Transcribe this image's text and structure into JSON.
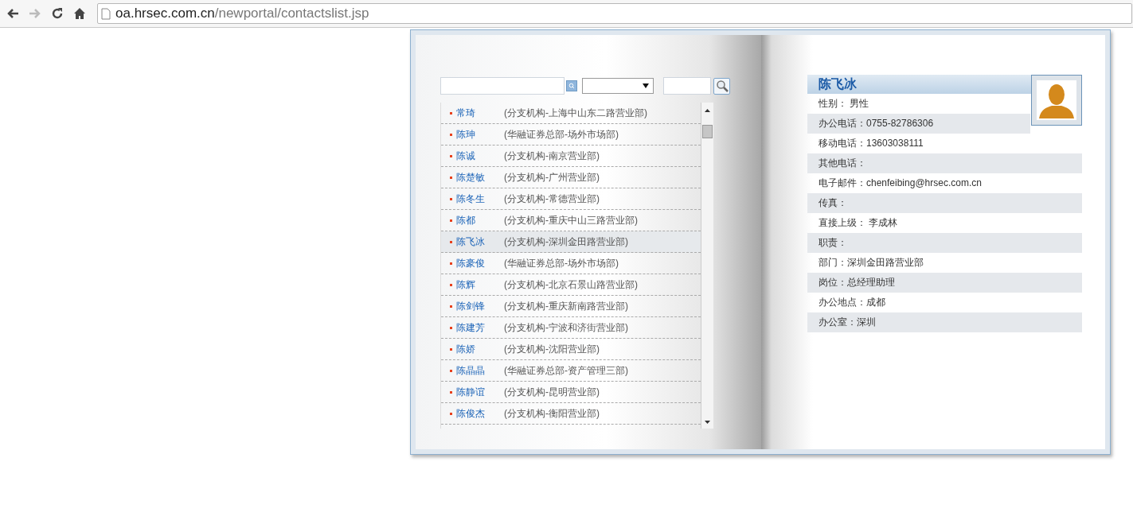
{
  "browser": {
    "url_host": "oa.hrsec.com.cn",
    "url_path": "/newportal/contactslist.jsp"
  },
  "contacts": [
    {
      "name": "常琦",
      "org": "(分支机构-上海中山东二路营业部)",
      "selected": false
    },
    {
      "name": "陈珅",
      "org": "(华融证券总部-场外市场部)",
      "selected": false
    },
    {
      "name": "陈诚",
      "org": "(分支机构-南京营业部)",
      "selected": false
    },
    {
      "name": "陈楚敏",
      "org": "(分支机构-广州营业部)",
      "selected": false
    },
    {
      "name": "陈冬生",
      "org": "(分支机构-常德营业部)",
      "selected": false
    },
    {
      "name": "陈都",
      "org": "(分支机构-重庆中山三路营业部)",
      "selected": false
    },
    {
      "name": "陈飞冰",
      "org": "(分支机构-深圳金田路营业部)",
      "selected": true
    },
    {
      "name": "陈豪俊",
      "org": "(华融证券总部-场外市场部)",
      "selected": false
    },
    {
      "name": "陈辉",
      "org": "(分支机构-北京石景山路营业部)",
      "selected": false
    },
    {
      "name": "陈剑锋",
      "org": "(分支机构-重庆新南路营业部)",
      "selected": false
    },
    {
      "name": "陈建芳",
      "org": "(分支机构-宁波和济街营业部)",
      "selected": false
    },
    {
      "name": "陈娇",
      "org": "(分支机构-沈阳营业部)",
      "selected": false
    },
    {
      "name": "陈晶晶",
      "org": "(华融证券总部-资产管理三部)",
      "selected": false
    },
    {
      "name": "陈静谊",
      "org": "(分支机构-昆明营业部)",
      "selected": false
    },
    {
      "name": "陈俊杰",
      "org": "(分支机构-衡阳营业部)",
      "selected": false
    }
  ],
  "detail": {
    "name": "陈飞冰",
    "fields": [
      "性别： 男性",
      "办公电话：0755-82786306",
      "移动电话：13603038111",
      "其他电话：",
      "电子邮件：chenfeibing@hrsec.com.cn",
      "传真：",
      "直接上级： 李成林",
      "职责：",
      "部门：深圳金田路营业部",
      "岗位：总经理助理",
      "办公地点：成都",
      "办公室：深圳"
    ]
  }
}
